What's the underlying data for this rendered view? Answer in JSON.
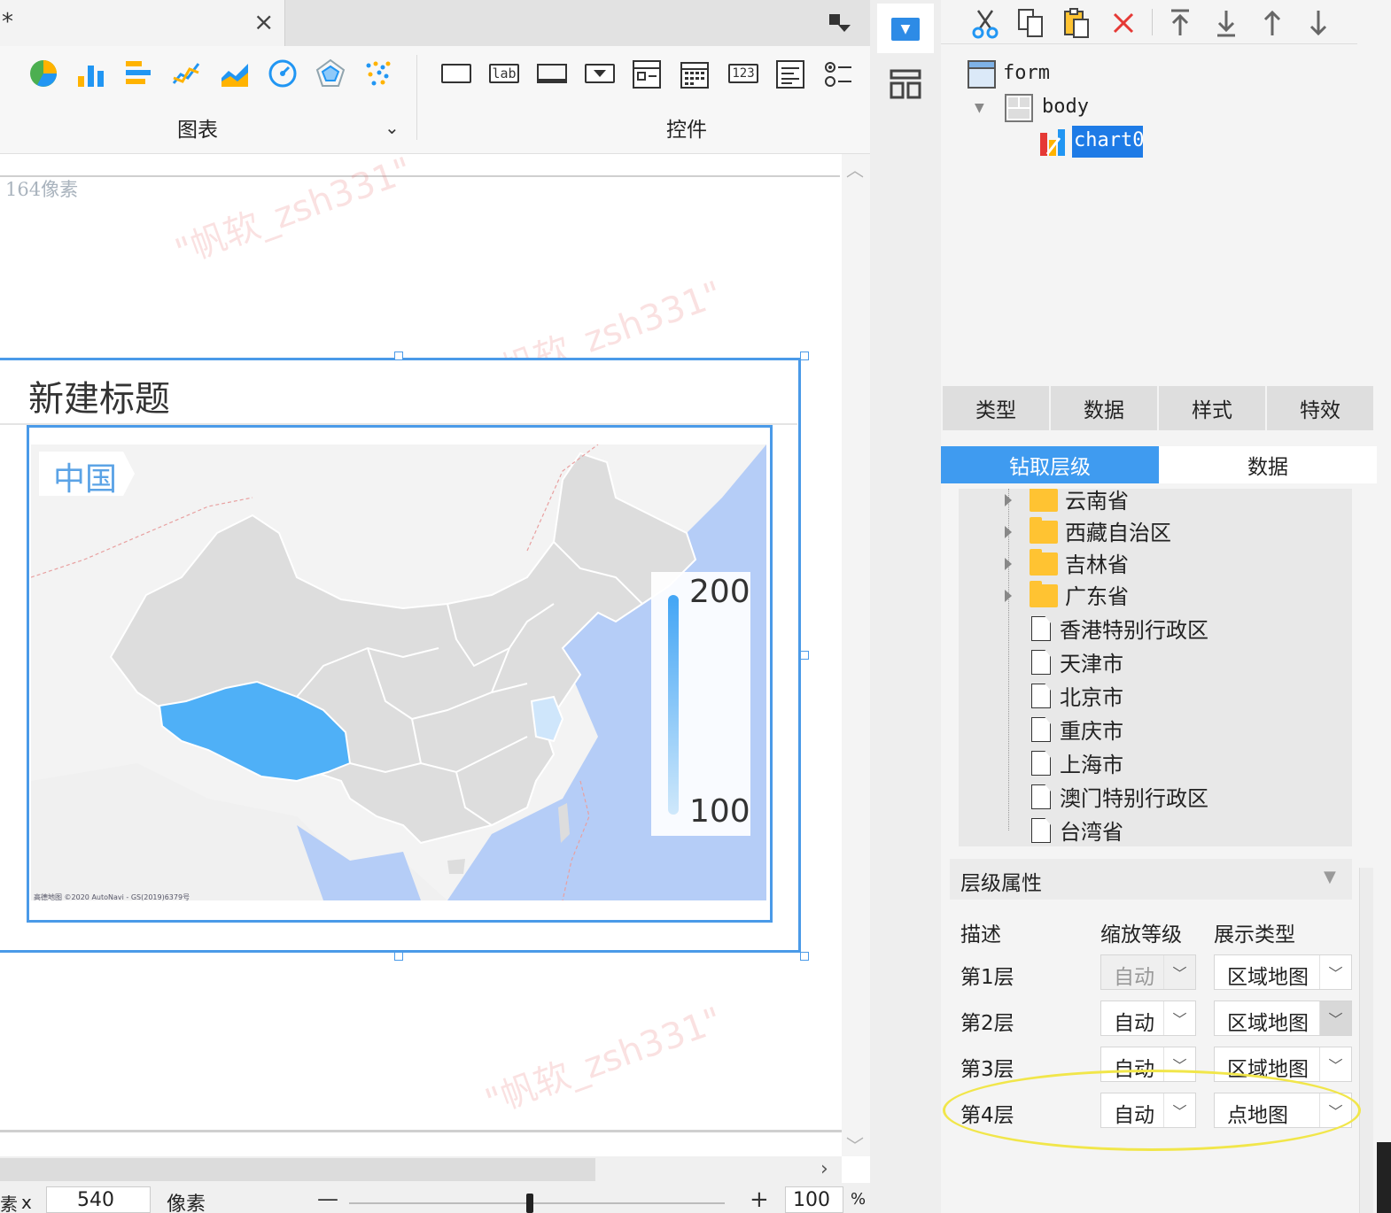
{
  "tab": {
    "modified_marker": "*",
    "close_glyph": "×"
  },
  "ribbon": {
    "chart_group_label": "图表",
    "widget_group_label": "控件",
    "chart_icons": [
      "pie-chart-icon",
      "bar-chart-icon",
      "horizontal-bar-chart-icon",
      "line-chart-icon",
      "area-chart-icon",
      "gauge-chart-icon",
      "radar-chart-icon",
      "scatter-chart-icon"
    ],
    "widget_icons": {
      "label_text": "lab",
      "number_text": "123"
    }
  },
  "canvas": {
    "ruler_label": "164像素",
    "watermark": "\"帆软_zsh331\"",
    "chart_title": "新建标题",
    "map_label": "中国",
    "legend_max": "200",
    "legend_min": "100",
    "attribution": "高德地图 ©2020 AutoNavi - GS(2019)6379号"
  },
  "status": {
    "x_label": "x",
    "left_edge_text": "素",
    "x_value": "540",
    "unit_label": "像素",
    "zoom_minus": "—",
    "zoom_plus": "+",
    "zoom_value": "100",
    "zoom_unit": "%",
    "zoom_level": 0.48
  },
  "component_tree": {
    "root": "form",
    "body": "body",
    "selected": "chart0"
  },
  "tabs": {
    "main": [
      "类型",
      "数据",
      "样式",
      "特效"
    ],
    "sub": [
      "钻取层级",
      "数据"
    ]
  },
  "drill_tree": {
    "folders": [
      "云南省",
      "西藏自治区",
      "吉林省",
      "广东省"
    ],
    "files": [
      "香港特别行政区",
      "天津市",
      "北京市",
      "重庆市",
      "上海市",
      "澳门特别行政区",
      "台湾省"
    ]
  },
  "level_props": {
    "header": "层级属性",
    "col_desc": "描述",
    "col_zoom": "缩放等级",
    "col_type": "展示类型",
    "rows": [
      {
        "label": "第1层",
        "zoom": "自动",
        "type": "区域地图"
      },
      {
        "label": "第2层",
        "zoom": "自动",
        "type": "区域地图"
      },
      {
        "label": "第3层",
        "zoom": "自动",
        "type": "区域地图"
      },
      {
        "label": "第4层",
        "zoom": "自动",
        "type": "点地图"
      }
    ]
  },
  "colors": {
    "accent": "#3f9bf0",
    "selection": "#1e7be6",
    "map_highlight": "#4fb0f7",
    "highlight_ellipse": "#f1e64a"
  }
}
